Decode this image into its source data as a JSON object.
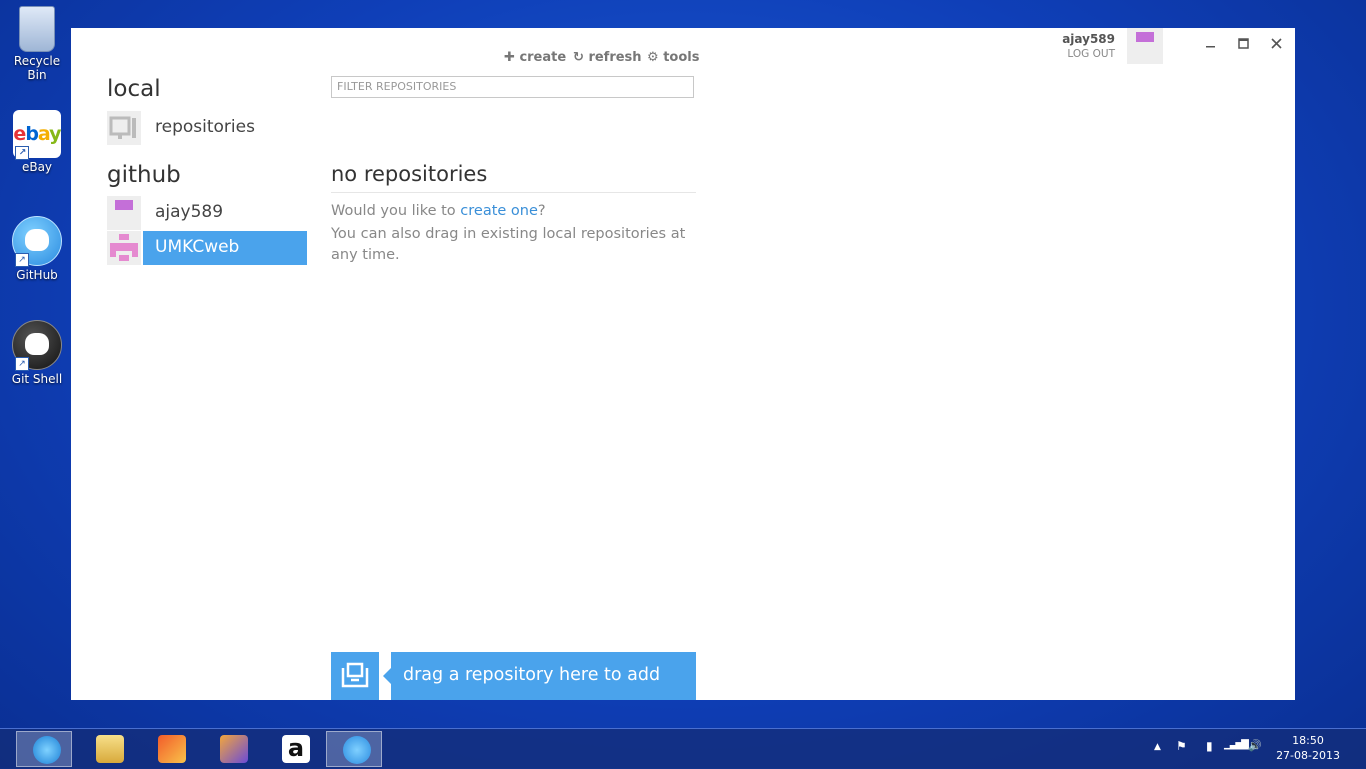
{
  "desktop": {
    "icons": [
      {
        "label": "Recycle Bin",
        "icon": "recycle-bin-icon"
      },
      {
        "label": "eBay",
        "icon": "ebay-icon"
      },
      {
        "label": "GitHub",
        "icon": "github-icon"
      },
      {
        "label": "Git Shell",
        "icon": "git-shell-icon"
      }
    ],
    "ebay_logo": [
      "e",
      "b",
      "a",
      "y"
    ]
  },
  "app": {
    "user": {
      "name": "ajay589",
      "logout": "LOG OUT",
      "avatar_color": "#c46fd8"
    },
    "toolbar": {
      "create": "create",
      "refresh": "refresh",
      "tools": "tools"
    },
    "sidebar": {
      "local_heading": "local",
      "local_items": [
        {
          "label": "repositories",
          "icon": "computer-icon"
        }
      ],
      "github_heading": "github",
      "github_items": [
        {
          "label": "ajay589",
          "avatar_color": "#c46fd8",
          "selected": false
        },
        {
          "label": "UMKCweb",
          "avatar_color": "#e58ad0",
          "selected": true
        }
      ]
    },
    "filter": {
      "placeholder": "FILTER REPOSITORIES"
    },
    "empty": {
      "title": "no repositories",
      "line1_prefix": "Would you like to ",
      "line1_link": "create one",
      "line1_suffix": "?",
      "line2": "You can also drag in existing local repositories at any time."
    },
    "drop": {
      "label": "drag a repository here to add"
    },
    "accent": "#4aa3ec"
  },
  "taskbar": {
    "apps": [
      "internet-explorer-icon",
      "file-explorer-icon",
      "media-center-icon",
      "media-player-icon",
      "amazon-icon",
      "github-icon"
    ],
    "amazon_glyph": "a",
    "tray": {
      "chevron": "▲",
      "flag": "⚑",
      "battery": "▮",
      "signal": "▁▃▅▇",
      "volume": "🔊"
    },
    "clock": {
      "time": "18:50",
      "date": "27-08-2013"
    }
  }
}
